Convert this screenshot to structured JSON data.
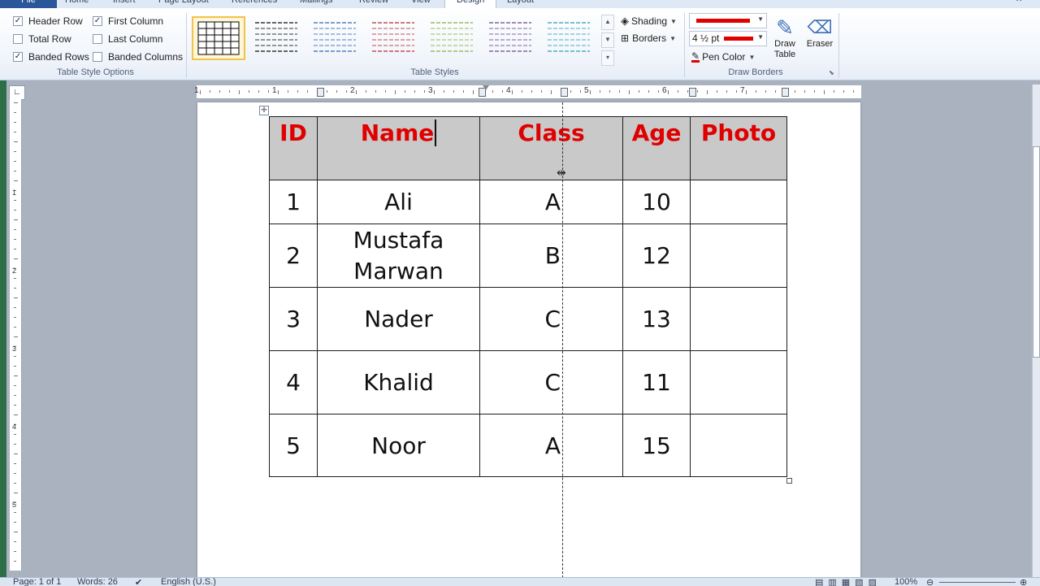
{
  "ribbon_tabs": [
    {
      "label": "File"
    },
    {
      "label": "Home"
    },
    {
      "label": "Insert"
    },
    {
      "label": "Page Layout"
    },
    {
      "label": "References"
    },
    {
      "label": "Mailings"
    },
    {
      "label": "Review"
    },
    {
      "label": "View"
    },
    {
      "label": "Design"
    },
    {
      "label": "Layout"
    }
  ],
  "active_tab": "Design",
  "table_style_options": {
    "label": "Table Style Options",
    "items": [
      {
        "label": "Header Row",
        "checked": true
      },
      {
        "label": "First Column",
        "checked": true
      },
      {
        "label": "Total Row",
        "checked": false
      },
      {
        "label": "Last Column",
        "checked": false
      },
      {
        "label": "Banded Rows",
        "checked": true
      },
      {
        "label": "Banded Columns",
        "checked": false
      }
    ]
  },
  "table_styles": {
    "label": "Table Styles",
    "thumb_colors": [
      "#000000",
      "#333333",
      "#4f81bd",
      "#c0504d",
      "#9bbb59",
      "#8064a2",
      "#4bacc6"
    ]
  },
  "shading": {
    "label": "Shading"
  },
  "borders": {
    "label": "Borders"
  },
  "draw_borders": {
    "label": "Draw Borders",
    "pen_weight": "4 ½ pt",
    "pen_color_label": "Pen Color",
    "pen_color": "#ff0000",
    "draw_table_label": "Draw Table",
    "eraser_label": "Eraser"
  },
  "table": {
    "headers": [
      "ID",
      "Name",
      "Class",
      "Age",
      "Photo"
    ],
    "rows": [
      {
        "id": "1",
        "name": "Ali",
        "class": "A",
        "age": "10",
        "photo": ""
      },
      {
        "id": "2",
        "name": "Mustafa Marwan",
        "class": "B",
        "age": "12",
        "photo": ""
      },
      {
        "id": "3",
        "name": "Nader",
        "class": "C",
        "age": "13",
        "photo": ""
      },
      {
        "id": "4",
        "name": "Khalid",
        "class": "C",
        "age": "11",
        "photo": ""
      },
      {
        "id": "5",
        "name": "Noor",
        "class": "A",
        "age": "15",
        "photo": ""
      }
    ]
  },
  "ruler_numbers": [
    "1",
    "1",
    "2",
    "3",
    "4",
    "5",
    "6",
    "7"
  ],
  "status": {
    "page": "Page: 1 of 1",
    "words": "Words: 26",
    "language": "English (U.S.)",
    "zoom": "100%"
  }
}
